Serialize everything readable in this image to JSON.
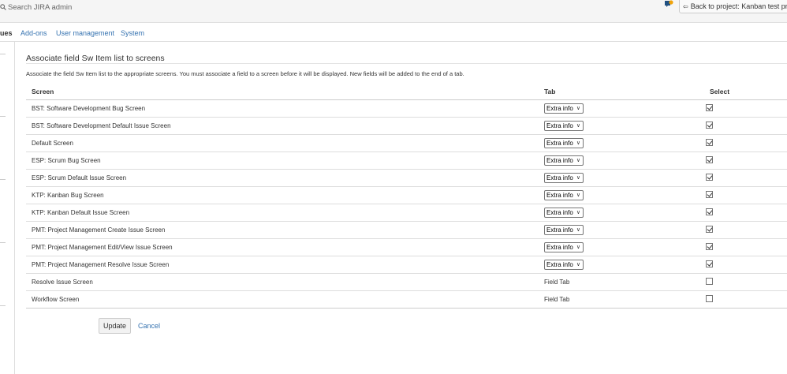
{
  "header": {
    "search_placeholder": "Search JIRA admin",
    "back_button_label": "Back to project: Kanban test pro"
  },
  "admin_tabs": [
    {
      "label": "ues",
      "active": true
    },
    {
      "label": "Add-ons",
      "active": false
    },
    {
      "label": "User management",
      "active": false
    },
    {
      "label": "System",
      "active": false
    }
  ],
  "section": {
    "title": "Associate field Sw Item list to screens",
    "description": "Associate the field Sw Item list to the appropriate screens. You must associate a field to a screen before it will be displayed. New fields will be added to the end of a tab."
  },
  "table": {
    "columns": {
      "screen": "Screen",
      "tab": "Tab",
      "select": "Select"
    },
    "rows": [
      {
        "screen": "BST: Software Development Bug Screen",
        "tab": "Extra info",
        "tab_is_select": true,
        "checked": true
      },
      {
        "screen": "BST: Software Development Default Issue Screen",
        "tab": "Extra info",
        "tab_is_select": true,
        "checked": true
      },
      {
        "screen": "Default Screen",
        "tab": "Extra info",
        "tab_is_select": true,
        "checked": true
      },
      {
        "screen": "ESP: Scrum Bug Screen",
        "tab": "Extra info",
        "tab_is_select": true,
        "checked": true
      },
      {
        "screen": "ESP: Scrum Default Issue Screen",
        "tab": "Extra info",
        "tab_is_select": true,
        "checked": true
      },
      {
        "screen": "KTP: Kanban Bug Screen",
        "tab": "Extra info",
        "tab_is_select": true,
        "checked": true
      },
      {
        "screen": "KTP: Kanban Default Issue Screen",
        "tab": "Extra info",
        "tab_is_select": true,
        "checked": true
      },
      {
        "screen": "PMT: Project Management Create Issue Screen",
        "tab": "Extra info",
        "tab_is_select": true,
        "checked": true
      },
      {
        "screen": "PMT: Project Management Edit/View Issue Screen",
        "tab": "Extra info",
        "tab_is_select": true,
        "checked": true
      },
      {
        "screen": "PMT: Project Management Resolve Issue Screen",
        "tab": "Extra info",
        "tab_is_select": true,
        "checked": true
      },
      {
        "screen": "Resolve Issue Screen",
        "tab": "Field Tab",
        "tab_is_select": false,
        "checked": false
      },
      {
        "screen": "Workflow Screen",
        "tab": "Field Tab",
        "tab_is_select": false,
        "checked": false
      }
    ]
  },
  "actions": {
    "update_label": "Update",
    "cancel_label": "Cancel"
  },
  "colors": {
    "link": "#3572b0",
    "topbar_bg": "#f5f5f5",
    "notification_badge": "#f0a30a"
  }
}
